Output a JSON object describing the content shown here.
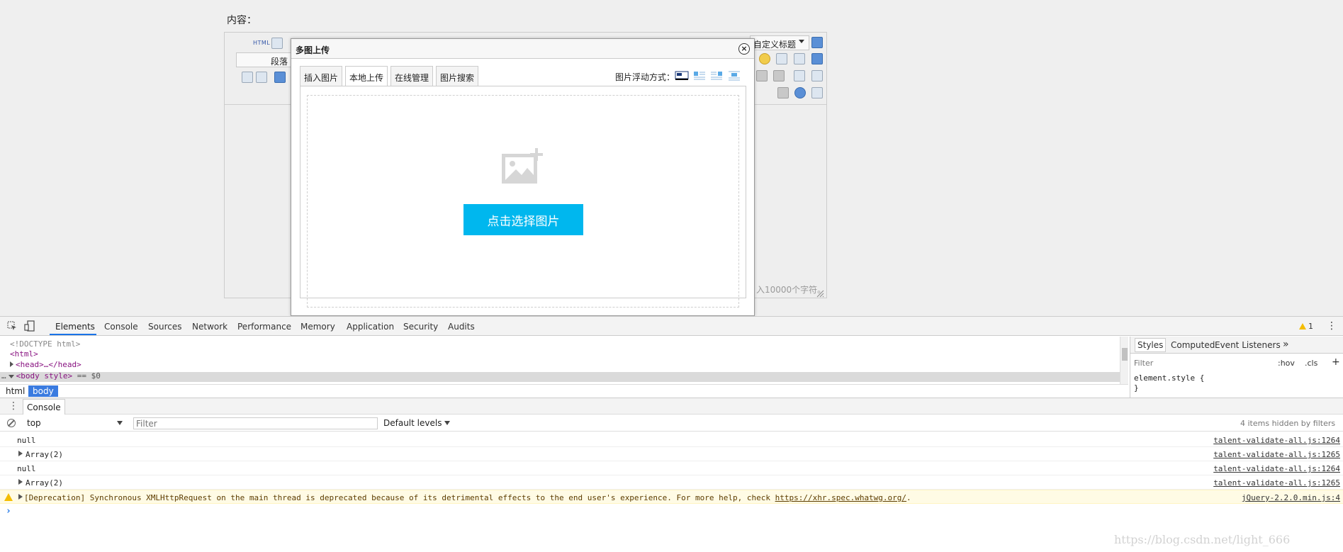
{
  "page": {
    "content_label": "内容：",
    "editor": {
      "html_button": "HTML",
      "paragraph_select": "段落",
      "title_select": "自定义标题",
      "char_count": "入10000个字符。"
    }
  },
  "modal": {
    "title": "多图上传",
    "close_symbol": "×",
    "tabs": [
      "插入图片",
      "本地上传",
      "在线管理",
      "图片搜索"
    ],
    "active_tab": "本地上传",
    "float_label": "图片浮动方式：",
    "pick_button": "点击选择图片",
    "accent_color": "#00b7ee"
  },
  "devtools": {
    "tabs": [
      "Elements",
      "Console",
      "Sources",
      "Network",
      "Performance",
      "Memory",
      "Application",
      "Security",
      "Audits"
    ],
    "active_tab": "Elements",
    "warning_count": "1",
    "elements": {
      "doctype": "<!DOCTYPE html>",
      "html_open": "<html>",
      "head": "<head>…</head>",
      "body_prefix": "…",
      "body_tag": "<body style>",
      "body_suffix": " == $0"
    },
    "breadcrumbs": [
      "html",
      "body"
    ],
    "styles": {
      "tabs": [
        "Styles",
        "Computed",
        "Event Listeners",
        "»"
      ],
      "filter_placeholder": "Filter",
      "hov": ":hov",
      "cls": ".cls",
      "plus": "+",
      "rule": "element.style {",
      "brace": "}"
    },
    "drawer_tab": "Console",
    "console": {
      "context": "top",
      "filter_placeholder": "Filter",
      "default_levels": "Default levels",
      "hidden_count": "4 items hidden by filters",
      "messages": [
        {
          "text": "null",
          "source": "talent-validate-all.js:1264"
        },
        {
          "text": "Array(2)",
          "source": "talent-validate-all.js:1265"
        },
        {
          "text": "null",
          "source": "talent-validate-all.js:1264"
        },
        {
          "text": "Array(2)",
          "source": "talent-validate-all.js:1265"
        },
        {
          "text": "[Deprecation] Synchronous XMLHttpRequest on the main thread is deprecated because of its detrimental effects to the end user's experience. For more help, check ",
          "link": "https://xhr.spec.whatwg.org/",
          "tail": ".",
          "source": "jQuery-2.2.0.min.js:4"
        }
      ],
      "prompt": "›"
    }
  },
  "watermark": "https://blog.csdn.net/light_666"
}
